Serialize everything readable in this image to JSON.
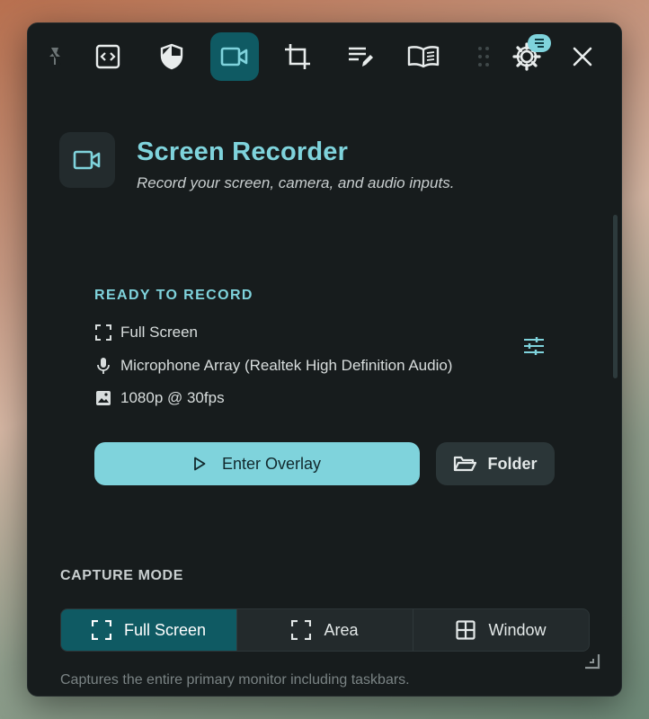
{
  "toolbar": {
    "items": [
      {
        "name": "pin",
        "icon": "pin-icon"
      },
      {
        "name": "code",
        "icon": "code-icon"
      },
      {
        "name": "shield",
        "icon": "shield-icon"
      },
      {
        "name": "recorder",
        "icon": "video-camera-icon",
        "active": true
      },
      {
        "name": "crop",
        "icon": "crop-icon"
      },
      {
        "name": "notes",
        "icon": "edit-list-icon"
      },
      {
        "name": "reader",
        "icon": "open-book-icon"
      },
      {
        "name": "settings",
        "icon": "gear-icon"
      },
      {
        "name": "close",
        "icon": "close-icon"
      }
    ]
  },
  "header": {
    "title": "Screen Recorder",
    "subtitle": "Record your screen, camera, and audio inputs."
  },
  "ready": {
    "label": "READY TO RECORD",
    "capture": "Full Screen",
    "microphone": "Microphone Array (Realtek High Definition Audio)",
    "quality": "1080p @ 30fps",
    "primary_label": "Enter Overlay",
    "secondary_label": "Folder"
  },
  "capture_mode": {
    "title": "CAPTURE MODE",
    "options": [
      {
        "label": "Full Screen",
        "active": true
      },
      {
        "label": "Area",
        "active": false
      },
      {
        "label": "Window",
        "active": false
      }
    ],
    "description": "Captures the entire primary monitor including taskbars."
  },
  "colors": {
    "accent": "#7fd3dc",
    "active_bg": "#0f5a63",
    "panel_bg": "#171c1d"
  }
}
